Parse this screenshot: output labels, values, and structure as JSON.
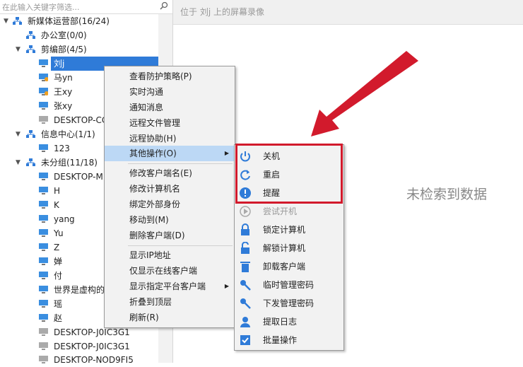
{
  "search": {
    "placeholder": "在此输入关键字筛选..."
  },
  "topbar": {
    "title": "位于 刘j 上的屏幕录像"
  },
  "main": {
    "empty_text": "未检索到数据"
  },
  "tree": [
    {
      "label": "新媒体运营部(16/24)",
      "kind": "group",
      "expanded": true
    },
    {
      "label": "办公室(0/0)",
      "kind": "group"
    },
    {
      "label": "剪编部(4/5)",
      "kind": "group",
      "expanded": true
    },
    {
      "label": "刘j",
      "kind": "pc",
      "selected": true
    },
    {
      "label": "马yn",
      "kind": "pc-warn"
    },
    {
      "label": "王xy",
      "kind": "pc-warn"
    },
    {
      "label": "张xy",
      "kind": "pc"
    },
    {
      "label": "DESKTOP-CC",
      "kind": "pc-off"
    },
    {
      "label": "信息中心(1/1)",
      "kind": "group",
      "expanded": true
    },
    {
      "label": "123",
      "kind": "pc"
    },
    {
      "label": "未分组(11/18)",
      "kind": "group",
      "expanded": true
    },
    {
      "label": "DESKTOP-M",
      "kind": "pc"
    },
    {
      "label": "H",
      "kind": "pc"
    },
    {
      "label": "K",
      "kind": "pc"
    },
    {
      "label": "yang",
      "kind": "pc"
    },
    {
      "label": "Yu",
      "kind": "pc"
    },
    {
      "label": "Z",
      "kind": "pc"
    },
    {
      "label": "婵",
      "kind": "pc"
    },
    {
      "label": "付",
      "kind": "pc"
    },
    {
      "label": "世界是虚构的",
      "kind": "pc"
    },
    {
      "label": "瑶",
      "kind": "pc"
    },
    {
      "label": "赵",
      "kind": "pc"
    },
    {
      "label": "DESKTOP-J0IC3G1",
      "kind": "pc-off"
    },
    {
      "label": "DESKTOP-J0IC3G1",
      "kind": "pc-off"
    },
    {
      "label": "DESKTOP-NOD9FI5",
      "kind": "pc-off"
    }
  ],
  "context_menu": {
    "items": [
      "查看防护策略(P)",
      "实时沟通",
      "通知消息",
      "远程文件管理",
      "远程协助(H)",
      "其他操作(O)",
      "修改客户端名(E)",
      "修改计算机名",
      "绑定外部身份",
      "移动到(M)",
      "删除客户端(D)",
      "显示IP地址",
      "仅显示在线客户端",
      "显示指定平台客户端",
      "折叠到顶层",
      "刷新(R)"
    ]
  },
  "submenu": {
    "items": [
      {
        "label": "关机",
        "icon": "power-icon"
      },
      {
        "label": "重启",
        "icon": "restart-icon"
      },
      {
        "label": "提醒",
        "icon": "alert-icon"
      },
      {
        "label": "尝试开机",
        "icon": "play-icon",
        "disabled": true
      },
      {
        "label": "锁定计算机",
        "icon": "lock-icon"
      },
      {
        "label": "解锁计算机",
        "icon": "unlock-icon"
      },
      {
        "label": "卸载客户端",
        "icon": "trash-icon"
      },
      {
        "label": "临时管理密码",
        "icon": "key-icon"
      },
      {
        "label": "下发管理密码",
        "icon": "key-icon"
      },
      {
        "label": "提取日志",
        "icon": "user-icon"
      },
      {
        "label": "批量操作",
        "icon": "checkbox-icon"
      }
    ]
  },
  "colors": {
    "accent": "#2f7bd8",
    "highlight": "#d21a2c"
  }
}
